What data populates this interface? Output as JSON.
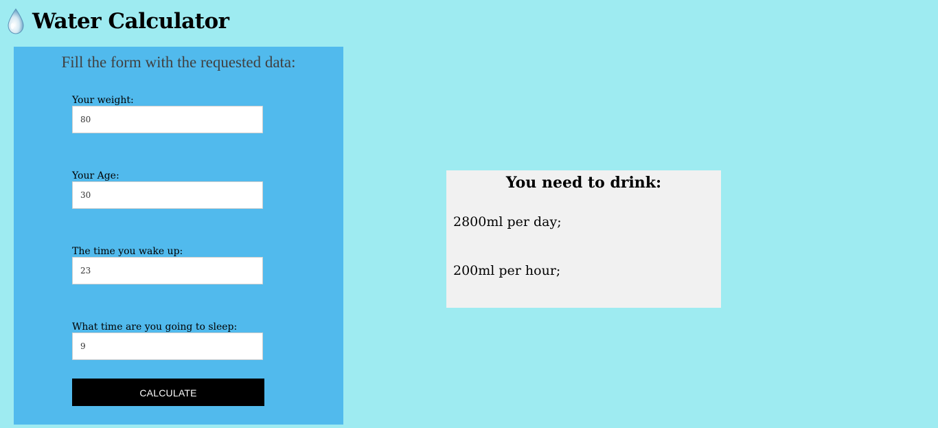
{
  "app": {
    "title": "Water Calculator",
    "icon": "water-drop-icon"
  },
  "form": {
    "heading": "Fill the form with the requested data:",
    "fields": [
      {
        "label": "Your weight:",
        "value": "80"
      },
      {
        "label": "Your Age:",
        "value": "30"
      },
      {
        "label": "The time you wake up:",
        "value": "23"
      },
      {
        "label": "What time are you going to sleep:",
        "value": "9"
      }
    ],
    "submit_label": "CALCULATE"
  },
  "result": {
    "heading": "You need to drink:",
    "per_day": "2800ml per day;",
    "per_hour": "200ml per hour;"
  },
  "colors": {
    "page_background": "#9eebf1",
    "form_background": "#51baed",
    "result_background": "#f1f1f1",
    "button_background": "#000000"
  }
}
